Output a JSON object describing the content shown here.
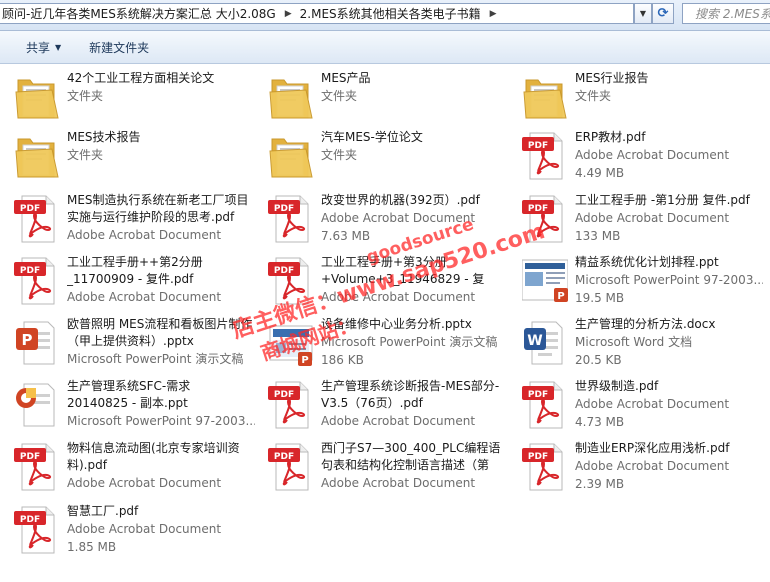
{
  "address": {
    "crumbs": [
      "顾问-近几年各类MES系统解决方案汇总 大小2.08G",
      "2.MES系统其他相关各类电子书籍"
    ],
    "search_placeholder": "搜索 2.MES系..."
  },
  "toolbar": {
    "share_label": "共享",
    "new_folder_label": "新建文件夹"
  },
  "files": [
    {
      "kind": "folder",
      "name": "42个工业工程方面相关论文",
      "sub1": "文件夹",
      "sub2": ""
    },
    {
      "kind": "folder",
      "name": "MES产品",
      "sub1": "文件夹",
      "sub2": ""
    },
    {
      "kind": "folder",
      "name": "MES行业报告",
      "sub1": "文件夹",
      "sub2": ""
    },
    {
      "kind": "folder",
      "name": "MES技术报告",
      "sub1": "文件夹",
      "sub2": ""
    },
    {
      "kind": "folder",
      "name": "汽车MES-学位论文",
      "sub1": "文件夹",
      "sub2": ""
    },
    {
      "kind": "pdf",
      "name": "ERP教材.pdf",
      "sub1": "Adobe Acrobat Document",
      "sub2": "4.49 MB"
    },
    {
      "kind": "pdf",
      "name": "MES制造执行系统在新老工厂项目实施与运行维护阶段的思考.pdf",
      "sub1": "Adobe Acrobat Document",
      "sub2": ""
    },
    {
      "kind": "pdf",
      "name": "改变世界的机器(392页）.pdf",
      "sub1": "Adobe Acrobat Document",
      "sub2": "7.63 MB"
    },
    {
      "kind": "pdf",
      "name": "工业工程手册 -第1分册 复件.pdf",
      "sub1": "Adobe Acrobat Document",
      "sub2": "133 MB"
    },
    {
      "kind": "pdf",
      "name": "工业工程手册++第2分册_11700909 - 复件.pdf",
      "sub1": "Adobe Acrobat Document",
      "sub2": ""
    },
    {
      "kind": "pdf",
      "name": "工业工程手册+第3分册+Volume+3_11946829 - 复件.p...",
      "sub1": "Adobe Acrobat Document",
      "sub2": ""
    },
    {
      "kind": "ppt",
      "name": "精益系统优化计划排程.ppt",
      "sub1": "Microsoft PowerPoint 97-2003...",
      "sub2": "19.5 MB"
    },
    {
      "kind": "pptx",
      "name": "欧普照明 MES流程和看板图片制作（甲上提供资料）.pptx",
      "sub1": "Microsoft PowerPoint 演示文稿",
      "sub2": ""
    },
    {
      "kind": "pptxthumb",
      "name": "设备维修中心业务分析.pptx",
      "sub1": "Microsoft PowerPoint 演示文稿",
      "sub2": "186 KB"
    },
    {
      "kind": "docx",
      "name": "生产管理的分析方法.docx",
      "sub1": "Microsoft Word 文档",
      "sub2": "20.5 KB"
    },
    {
      "kind": "pptold",
      "name": "生产管理系统SFC-需求 20140825 - 副本.ppt",
      "sub1": "Microsoft PowerPoint 97-2003...",
      "sub2": ""
    },
    {
      "kind": "pdf",
      "name": "生产管理系统诊断报告-MES部分-V3.5（76页）.pdf",
      "sub1": "Adobe Acrobat Document",
      "sub2": ""
    },
    {
      "kind": "pdf",
      "name": "世界级制造.pdf",
      "sub1": "Adobe Acrobat Document",
      "sub2": "4.73 MB"
    },
    {
      "kind": "pdf",
      "name": "物料信息流动图(北京专家培训资料).pdf",
      "sub1": "Adobe Acrobat Document",
      "sub2": ""
    },
    {
      "kind": "pdf",
      "name": "西门子S7—300_400_PLC编程语句表和结构化控制语言描述（第三...",
      "sub1": "Adobe Acrobat Document",
      "sub2": ""
    },
    {
      "kind": "pdf",
      "name": "制造业ERP深化应用浅析.pdf",
      "sub1": "Adobe Acrobat Document",
      "sub2": "2.39 MB"
    },
    {
      "kind": "pdf",
      "name": "智慧工厂.pdf",
      "sub1": "Adobe Acrobat Document",
      "sub2": "1.85 MB"
    }
  ],
  "watermark": {
    "line1": "goodsource",
    "line2": "店主微信：www.sap520.com",
    "line3": "商城网站："
  },
  "colors": {
    "pdf_red": "#d8262a",
    "folder_yellow": "#f0c95a",
    "ppt_orange": "#d04423",
    "word_blue": "#2b5797",
    "watermark_red": "#ff2a2a"
  }
}
